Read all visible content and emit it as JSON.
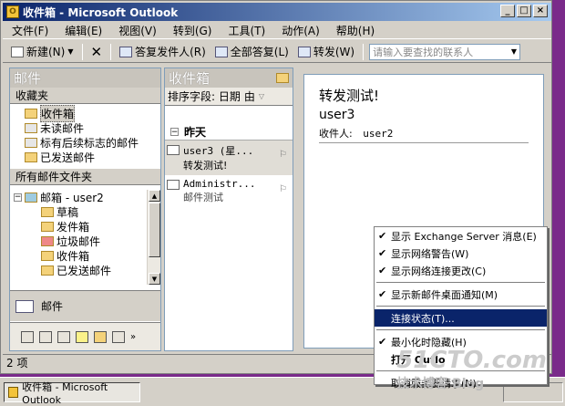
{
  "window": {
    "title": "收件箱 - Microsoft Outlook",
    "controls": [
      "_",
      "□",
      "×"
    ]
  },
  "menubar": [
    "文件(F)",
    "编辑(E)",
    "视图(V)",
    "转到(G)",
    "工具(T)",
    "动作(A)",
    "帮助(H)"
  ],
  "toolbar": {
    "new": "新建(N)",
    "reply": "答复发件人(R)",
    "reply_all": "全部答复(L)",
    "forward": "转发(W)",
    "search_placeholder": "请输入要查找的联系人"
  },
  "nav": {
    "header": "邮件",
    "favorites_title": "收藏夹",
    "favorites": [
      "收件箱",
      "未读邮件",
      "标有后续标志的邮件",
      "已发送邮件"
    ],
    "all_folders_title": "所有邮件文件夹",
    "mailbox": "邮箱 - user2",
    "folders": [
      "草稿",
      "发件箱",
      "垃圾邮件",
      "收件箱",
      "已发送邮件"
    ],
    "mail_button": "邮件"
  },
  "list": {
    "header": "收件箱",
    "sort_label": "排序字段: 日期",
    "sort_by": "由",
    "group": "昨天",
    "messages": [
      {
        "from": "user3 (星...",
        "subject": "转发测试!"
      },
      {
        "from": "Administr...",
        "subject": "邮件测试"
      }
    ]
  },
  "reading": {
    "subject": "转发测试!",
    "from": "user3",
    "to_label": "收件人:",
    "to_value": "user2"
  },
  "status": {
    "text": "2 项"
  },
  "context_menu": {
    "items": [
      {
        "label": "显示 Exchange Server 消息(E)",
        "checked": true
      },
      {
        "label": "显示网络警告(W)",
        "checked": true
      },
      {
        "label": "显示网络连接更改(C)",
        "checked": true
      },
      {
        "label": "显示新邮件桌面通知(M)",
        "checked": true
      },
      {
        "label": "连接状态(T)...",
        "checked": false,
        "highlighted": true
      },
      {
        "label": "最小化时隐藏(H)",
        "checked": true
      },
      {
        "label": "打开 Outlo",
        "checked": false,
        "bold": true
      },
      {
        "label": "取消服务器请求(N)",
        "checked": false
      }
    ]
  },
  "taskbar": {
    "button": "收件箱 - Microsoft Outlook"
  },
  "watermark": {
    "line1": "51CTO.com",
    "line2": "技术博客 Blog"
  }
}
